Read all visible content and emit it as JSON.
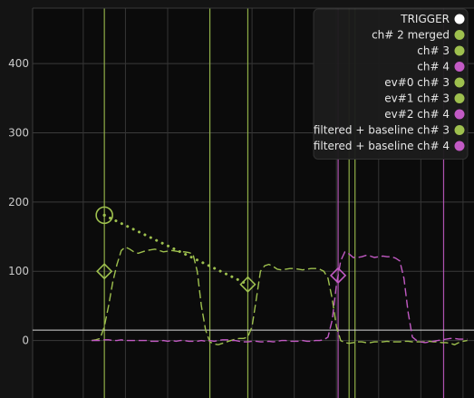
{
  "chart_data": {
    "type": "line",
    "title": "",
    "xlabel": "",
    "ylabel": "",
    "ylim": [
      -83,
      480
    ],
    "legend_position": "top-right",
    "y_ticks": [
      0,
      100,
      200,
      300,
      400
    ],
    "grid": true,
    "baseline_threshold": 15,
    "colors": {
      "green": "#9ec04e",
      "magenta": "#c25ac4",
      "trigger": "#ffffff"
    },
    "legend": [
      {
        "label": "TRIGGER",
        "color": "#ffffff"
      },
      {
        "label": "ch# 2 merged",
        "color": "#9ec04e"
      },
      {
        "label": "ch# 3",
        "color": "#9ec04e"
      },
      {
        "label": "ch# 4",
        "color": "#c25ac4"
      },
      {
        "label": "ev#0 ch# 3",
        "color": "#9ec04e"
      },
      {
        "label": "ev#1 ch# 3",
        "color": "#9ec04e"
      },
      {
        "label": "ev#2 ch# 4",
        "color": "#c25ac4"
      },
      {
        "label": "filtered + baseline ch# 3",
        "color": "#9ec04e"
      },
      {
        "label": "filtered + baseline ch# 4",
        "color": "#c25ac4"
      }
    ],
    "x": [
      0,
      5,
      10,
      15,
      20,
      25,
      30,
      35,
      40,
      45,
      50,
      55,
      60,
      65,
      70,
      75,
      80,
      85,
      90,
      95,
      100,
      105,
      110,
      115,
      120,
      125,
      130,
      135,
      140,
      145,
      150,
      155,
      160,
      165,
      170,
      175,
      180,
      185,
      190,
      195,
      200,
      205,
      210,
      215,
      220,
      225,
      230,
      235,
      240,
      245,
      250,
      255,
      260,
      265,
      270,
      275,
      280,
      285,
      290,
      295,
      300,
      305,
      310,
      315,
      320,
      325,
      330,
      335,
      340,
      345,
      350,
      355,
      360,
      365,
      370,
      375,
      380,
      385,
      390,
      395,
      400,
      405,
      410,
      415,
      420,
      425,
      430,
      435,
      440,
      445,
      450,
      455,
      460,
      465,
      470,
      475,
      480,
      485,
      490,
      495,
      500,
      505,
      510,
      515
    ],
    "series": [
      {
        "name": "filtered + baseline ch# 3",
        "color": "#9ec04e",
        "style": "dashed",
        "values": [
          null,
          null,
          null,
          null,
          null,
          null,
          null,
          null,
          null,
          null,
          null,
          null,
          null,
          null,
          0,
          1,
          3,
          20,
          50,
          85,
          110,
          130,
          135,
          132,
          128,
          126,
          128,
          130,
          131,
          132,
          130,
          128,
          129,
          130,
          129,
          128,
          128,
          127,
          125,
          100,
          50,
          15,
          -2,
          -5,
          -6,
          -4,
          -2,
          0,
          2,
          3,
          3,
          5,
          20,
          60,
          100,
          108,
          110,
          107,
          103,
          102,
          103,
          104,
          104,
          103,
          102,
          103,
          104,
          104,
          103,
          100,
          90,
          60,
          20,
          0,
          -3,
          -4,
          -3,
          -2,
          -2,
          -3,
          -3,
          -2,
          -2,
          -2,
          -1,
          -2,
          -2,
          -2,
          -1,
          -1,
          -2,
          -2,
          -2,
          -2,
          -1,
          -2,
          -2,
          -3,
          -3,
          -4,
          -6,
          -3,
          -1,
          0
        ]
      },
      {
        "name": "filtered + baseline ch# 4",
        "color": "#c25ac4",
        "style": "dashed",
        "values": [
          null,
          null,
          null,
          null,
          null,
          null,
          null,
          null,
          null,
          null,
          null,
          null,
          null,
          null,
          0,
          0,
          0,
          1,
          1,
          0,
          0,
          1,
          0,
          0,
          0,
          0,
          0,
          0,
          -1,
          -1,
          -1,
          0,
          -1,
          0,
          -1,
          0,
          0,
          -1,
          -1,
          -1,
          0,
          -1,
          0,
          -1,
          0,
          1,
          1,
          0,
          0,
          -1,
          -2,
          -2,
          -1,
          -1,
          -2,
          -2,
          -1,
          -2,
          -1,
          0,
          0,
          -1,
          -1,
          -1,
          0,
          -1,
          -1,
          0,
          0,
          1,
          5,
          30,
          80,
          115,
          128,
          125,
          120,
          120,
          121,
          123,
          122,
          120,
          121,
          122,
          121,
          121,
          119,
          115,
          90,
          40,
          5,
          0,
          -2,
          -3,
          -2,
          -1,
          0,
          1,
          2,
          3,
          3,
          2,
          2,
          2
        ]
      },
      {
        "name": "ch# 2 merged",
        "color": "#9ec04e",
        "style": "dotted",
        "points": [
          [
            85,
            181
          ],
          [
            255,
            81
          ]
        ]
      }
    ],
    "vertical_markers": [
      {
        "x": 85,
        "color": "#9ec04e"
      },
      {
        "x": 210,
        "color": "#9ec04e"
      },
      {
        "x": 255,
        "color": "#9ec04e"
      },
      {
        "x": 375,
        "color": "#9ec04e"
      },
      {
        "x": 382,
        "color": "#9ec04e"
      },
      {
        "x": 362,
        "color": "#c25ac4"
      },
      {
        "x": 487,
        "color": "#c25ac4"
      }
    ],
    "markers": [
      {
        "shape": "circle",
        "x": 85,
        "y": 181,
        "color": "#9ec04e"
      },
      {
        "shape": "diamond",
        "x": 85,
        "y": 100,
        "color": "#9ec04e"
      },
      {
        "shape": "diamond",
        "x": 255,
        "y": 81,
        "color": "#9ec04e"
      },
      {
        "shape": "diamond",
        "x": 362,
        "y": 94,
        "color": "#c25ac4"
      }
    ]
  }
}
